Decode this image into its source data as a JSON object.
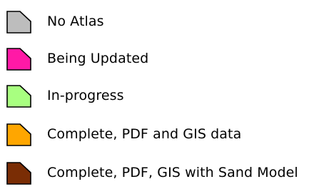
{
  "legend": {
    "items": [
      {
        "label": "No Atlas",
        "color": "#bdbdbd"
      },
      {
        "label": "Being Updated",
        "color": "#ff19a6"
      },
      {
        "label": "In-progress",
        "color": "#a8ff80"
      },
      {
        "label": "Complete, PDF and GIS data",
        "color": "#ffa600"
      },
      {
        "label": "Complete, PDF, GIS with Sand Model",
        "color": "#7a2d05"
      }
    ]
  }
}
